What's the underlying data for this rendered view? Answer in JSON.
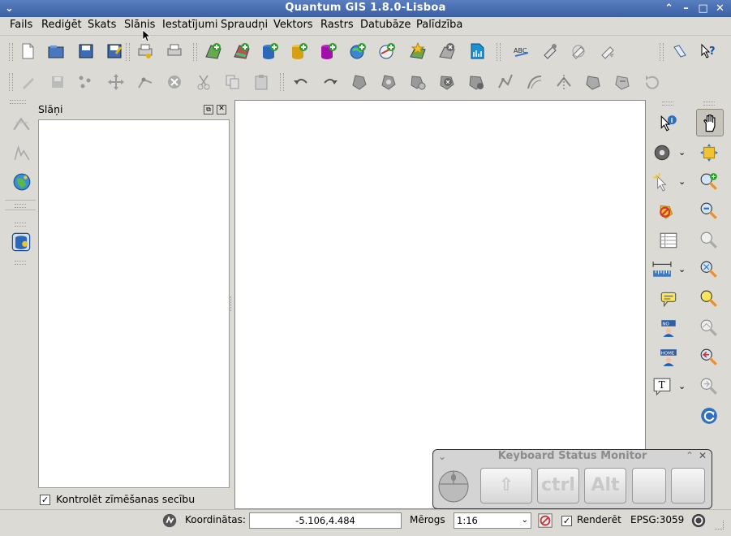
{
  "window": {
    "title": "Quantum GIS 1.8.0-Lisboa"
  },
  "menu": [
    "Fails",
    "Rediģēt",
    "Skats",
    "Slānis",
    "Iestatījumi",
    "Spraudņi",
    "Vektors",
    "Rastrs",
    "Datubāze",
    "Palīdzība"
  ],
  "layers_panel": {
    "title": "Slāņi",
    "render_order_label": "Kontrolēt zīmēšanas secību",
    "render_order_checked": true
  },
  "status": {
    "coord_label": "Koordinātas:",
    "coord_value": "-5.106,4.484",
    "scale_label": "Mērogs",
    "scale_value": "1:16",
    "render_label": "Renderēt",
    "render_checked": true,
    "crs": "EPSG:3059"
  },
  "keyboard_monitor": {
    "title": "Keyboard Status Monitor",
    "keys": [
      "⇧",
      "ctrl",
      "Alt",
      "",
      ""
    ]
  },
  "icons": {
    "file_toolbar": [
      "new-project-icon",
      "open-project-icon",
      "save-project-icon",
      "save-as-icon",
      "print-composer-icon",
      "print-icon"
    ],
    "layer_toolbar": [
      "add-vector-icon",
      "add-raster-icon",
      "add-postgis-icon",
      "add-spatialite-icon",
      "add-mssql-icon",
      "add-wms-icon",
      "add-wfs-icon",
      "new-shapefile-icon",
      "remove-layer-icon",
      "oracle-georaster-icon"
    ],
    "plugin_toolbar": [
      "spellcheck-icon",
      "plugin-a-icon",
      "plugin-b-icon",
      "plugin-c-icon",
      "help-icon",
      "whats-this-icon"
    ]
  }
}
